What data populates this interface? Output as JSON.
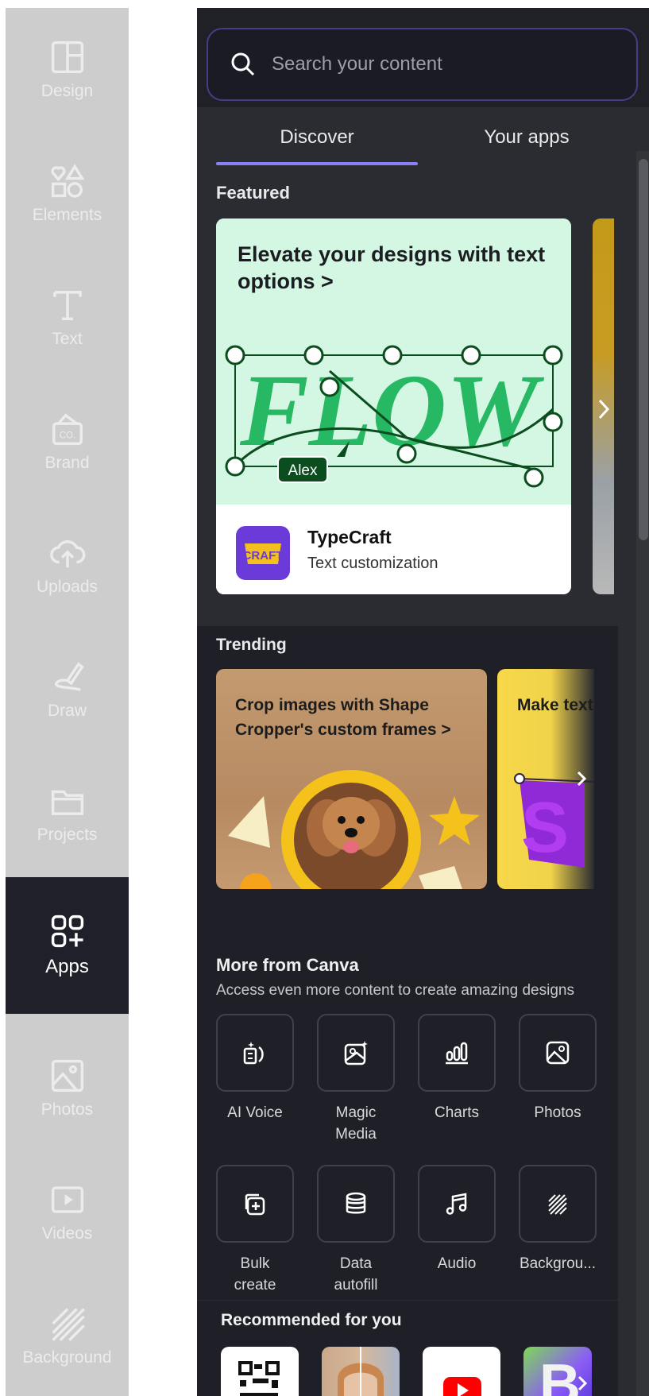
{
  "rail": {
    "items": [
      {
        "label": "Design",
        "icon": "layout-icon"
      },
      {
        "label": "Elements",
        "icon": "shapes-icon"
      },
      {
        "label": "Text",
        "icon": "text-icon"
      },
      {
        "label": "Brand",
        "icon": "brand-icon"
      },
      {
        "label": "Uploads",
        "icon": "cloud-upload-icon"
      },
      {
        "label": "Draw",
        "icon": "draw-icon"
      },
      {
        "label": "Projects",
        "icon": "folder-icon"
      },
      {
        "label": "Apps",
        "icon": "apps-icon",
        "active": true
      },
      {
        "label": "Photos",
        "icon": "image-icon"
      },
      {
        "label": "Videos",
        "icon": "video-icon"
      },
      {
        "label": "Background",
        "icon": "background-icon"
      }
    ]
  },
  "search": {
    "placeholder": "Search your content"
  },
  "tabs": {
    "discover": "Discover",
    "your_apps": "Your apps",
    "active": "Discover"
  },
  "featured": {
    "label": "Featured",
    "headline": "Elevate your designs with text options >",
    "art_word": "FLOW",
    "cursor_tag": "Alex",
    "app_name": "TypeCraft",
    "app_desc": "Text customization",
    "logo_text": "CRAFT"
  },
  "trending": {
    "label": "Trending",
    "cards": [
      {
        "title": "Crop images with Shape Cropper's custom frames >"
      },
      {
        "title": "Make text shape wit"
      }
    ]
  },
  "more_from_canva": {
    "title": "More from Canva",
    "subtitle": "Access even more content to create amazing designs",
    "tiles": [
      {
        "label": "AI Voice",
        "icon": "ai-voice-icon"
      },
      {
        "label": "Magic Media",
        "icon": "magic-media-icon"
      },
      {
        "label": "Charts",
        "icon": "charts-icon"
      },
      {
        "label": "Photos",
        "icon": "photos-icon"
      },
      {
        "label": "Bulk create",
        "icon": "bulk-create-icon"
      },
      {
        "label": "Data autofill",
        "icon": "database-icon"
      },
      {
        "label": "Audio",
        "icon": "music-note-icon"
      },
      {
        "label": "Backgrou...",
        "icon": "background-pattern-icon"
      }
    ]
  },
  "recommended": {
    "title": "Recommended for you"
  },
  "colors": {
    "accent": "#8b7ff5",
    "panel": "#2b2c31",
    "rail": "#cdcdcd"
  }
}
